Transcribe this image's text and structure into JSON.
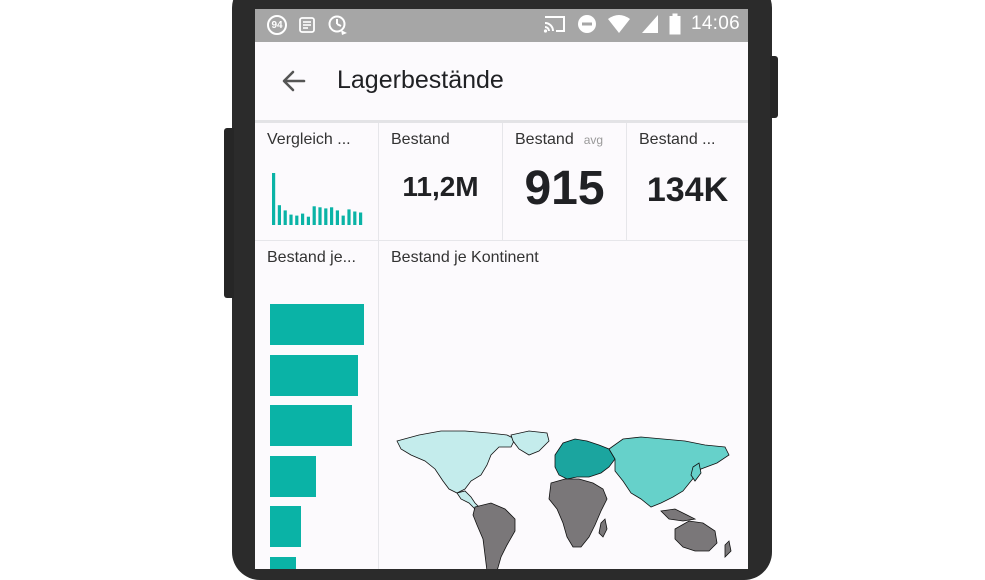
{
  "status_bar": {
    "badge": "94",
    "time": "14:06"
  },
  "app_bar": {
    "title": "Lagerbestände"
  },
  "tiles": {
    "vergleich": {
      "title": "Vergleich ..."
    },
    "bestand": {
      "title": "Bestand",
      "value": "11,2M"
    },
    "bestand_avg": {
      "title": "Bestand",
      "subtitle": "avg",
      "value": "915"
    },
    "bestand_3": {
      "title": "Bestand ...",
      "value": "134K"
    },
    "bestand_je": {
      "title": "Bestand je..."
    },
    "kontinent": {
      "title": "Bestand je Kontinent"
    }
  },
  "colors": {
    "accent": "#0ab3a6",
    "light_teal": "#c4ecec",
    "mid_teal": "#66d1ca",
    "dark_teal": "#1ba59f",
    "no_data": "#7a7779"
  },
  "chart_data": [
    {
      "type": "bar",
      "orientation": "vertical",
      "values": [
        100,
        38,
        28,
        20,
        18,
        22,
        16,
        36,
        34,
        32,
        34,
        28,
        18,
        30,
        26,
        24
      ]
    },
    {
      "type": "bar",
      "orientation": "horizontal",
      "values": [
        100,
        94,
        87,
        49,
        33,
        28
      ]
    }
  ]
}
